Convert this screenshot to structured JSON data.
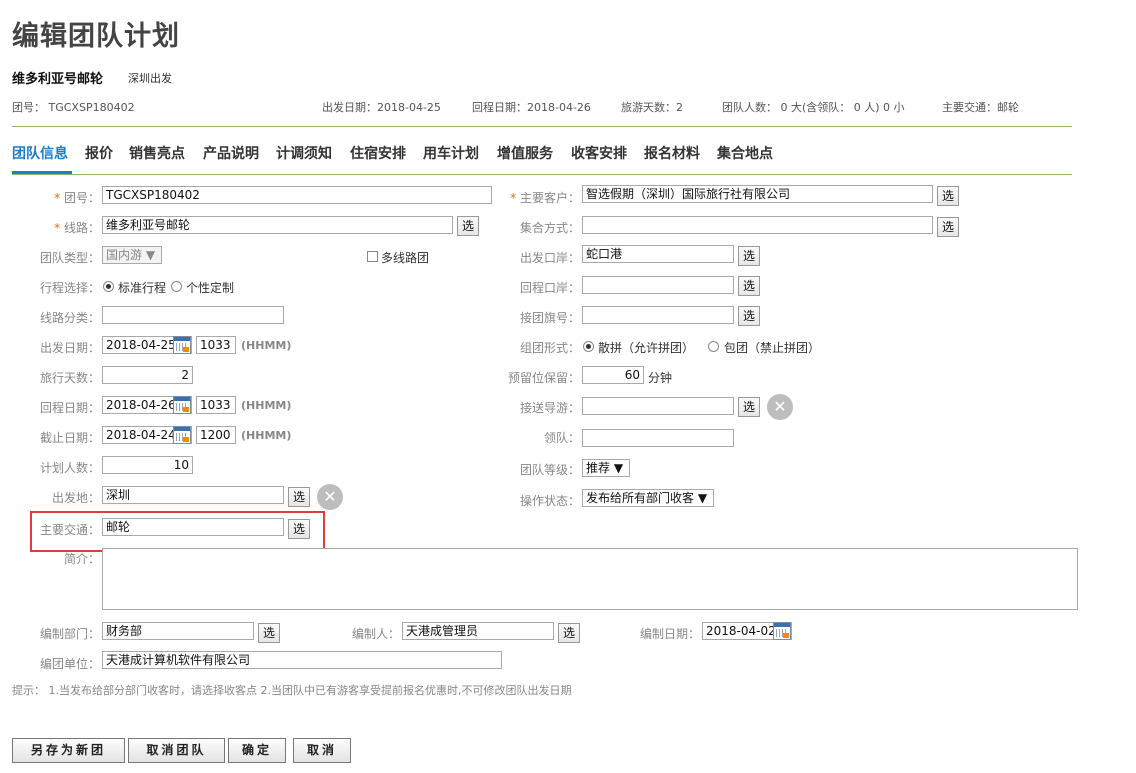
{
  "page": {
    "title": "编辑团队计划",
    "route_name": "维多利亚号邮轮",
    "route_departure": "深圳出发"
  },
  "meta": {
    "team_no": "团号： TGCXSP180402",
    "depart_date": "出发日期：2018-04-25",
    "return_date": "回程日期：2018-04-26",
    "travel_days": "旅游天数：2",
    "team_size": "团队人数： 0 大(含领队： 0 人) 0 小",
    "main_transport": "主要交通：邮轮"
  },
  "tabs": [
    "团队信息",
    "报价",
    "销售亮点",
    "产品说明",
    "计调须知",
    "住宿安排",
    "用车计划",
    "增值服务",
    "收客安排",
    "报名材料",
    "集合地点"
  ],
  "select_label": "选",
  "hhmm": "(HHMM)",
  "form": {
    "team_no": {
      "label": "团号：",
      "value": "TGCXSP180402"
    },
    "route": {
      "label": "线路：",
      "value": "维多利亚号邮轮"
    },
    "team_type": {
      "label": "团队类型：",
      "value": "国内游 ▼"
    },
    "multi_route": {
      "label": "多线路团"
    },
    "itinerary": {
      "label": "行程选择：",
      "options": [
        "标准行程",
        "个性定制"
      ]
    },
    "route_category": {
      "label": "线路分类：",
      "value": ""
    },
    "depart_date": {
      "label": "出发日期：",
      "value": "2018-04-25",
      "time": "1033"
    },
    "travel_days": {
      "label": "旅行天数：",
      "value": "2"
    },
    "return_date": {
      "label": "回程日期：",
      "value": "2018-04-26",
      "time": "1033"
    },
    "deadline": {
      "label": "截止日期：",
      "value": "2018-04-24",
      "time": "1200"
    },
    "planned_people": {
      "label": "计划人数：",
      "value": "10"
    },
    "depart_place": {
      "label": "出发地：",
      "value": "深圳"
    },
    "main_transport": {
      "label": "主要交通：",
      "value": "邮轮"
    },
    "intro": {
      "label": "简介："
    },
    "main_customer": {
      "label": "主要客户：",
      "value": "智选假期（深圳）国际旅行社有限公司"
    },
    "assembly": {
      "label": "集合方式：",
      "value": ""
    },
    "depart_port": {
      "label": "出发口岸：",
      "value": "蛇口港"
    },
    "return_port": {
      "label": "回程口岸：",
      "value": ""
    },
    "flag_no": {
      "label": "接团旗号：",
      "value": ""
    },
    "group_form": {
      "label": "组团形式：",
      "options": [
        "散拼（允许拼团）",
        "包团（禁止拼团）"
      ]
    },
    "reserve": {
      "label": "预留位保留：",
      "value": "60",
      "unit": "分钟"
    },
    "guide": {
      "label": "接送导游：",
      "value": ""
    },
    "leader": {
      "label": "领队：",
      "value": ""
    },
    "grade": {
      "label": "团队等级：",
      "value": "推荐 ▼"
    },
    "op_status": {
      "label": "操作状态：",
      "value": "发布给所有部门收客 ▼"
    },
    "dept": {
      "label": "编制部门：",
      "value": "财务部"
    },
    "editor": {
      "label": "编制人：",
      "value": "天港成管理员"
    },
    "edit_date": {
      "label": "编制日期：",
      "value": "2018-04-02"
    },
    "org": {
      "label": "编团单位：",
      "value": "天港成计算机软件有限公司"
    }
  },
  "tip": "提示： 1.当发布给部分部门收客时，请选择收客点 2.当团队中已有游客享受提前报名优惠时,不可修改团队出发日期",
  "buttons": {
    "save_as": "另存为新团",
    "cancel_team": "取消团队",
    "confirm": "确定",
    "cancel": "取消"
  }
}
